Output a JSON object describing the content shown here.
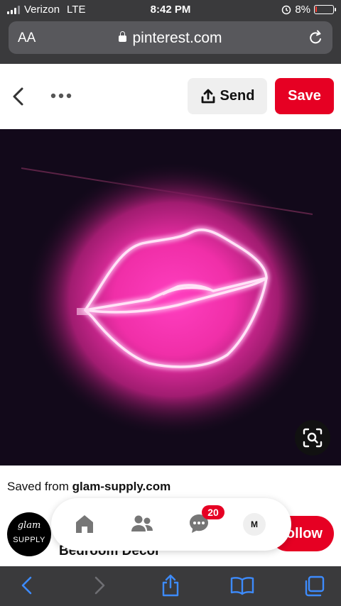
{
  "status_bar": {
    "carrier": "Verizon",
    "network": "LTE",
    "time": "8:42 PM",
    "battery_percent": "8%",
    "battery_level": 0.08
  },
  "browser": {
    "text_size_label": "AA",
    "domain": "pinterest.com"
  },
  "pin_actions": {
    "send_label": "Send",
    "save_label": "Save"
  },
  "pin": {
    "saved_from_prefix": "Saved from ",
    "saved_from_site": "glam-supply.com",
    "board_name": "Bedroom Decor"
  },
  "profile": {
    "avatar_script": "glam",
    "avatar_word": "SUPPLY",
    "follow_label": "Follow"
  },
  "bottom_nav": {
    "messages_badge": "20",
    "profile_initial": "M"
  },
  "colors": {
    "brand_red": "#e60023",
    "neon_pink": "#ff3fc0"
  },
  "icons": [
    "signal-icon",
    "alarm-icon",
    "battery-icon",
    "lock-icon",
    "reload-icon",
    "back-chevron-icon",
    "more-dots-icon",
    "share-upload-icon",
    "visual-search-icon",
    "home-icon",
    "people-icon",
    "chat-icon",
    "back-arrow-icon",
    "forward-arrow-icon",
    "share-icon",
    "bookmarks-icon",
    "tabs-icon"
  ]
}
